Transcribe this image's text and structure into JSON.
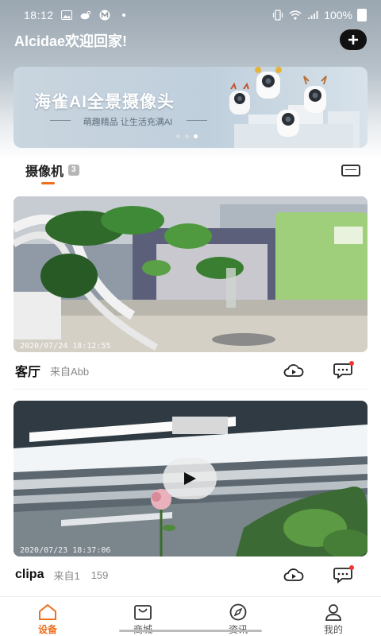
{
  "status_bar": {
    "time": "18:12",
    "battery": "100%"
  },
  "header": {
    "greeting": "Alcidae欢迎回家!",
    "add_icon": "plus-icon"
  },
  "banner": {
    "title": "海雀AI全景摄像头",
    "subtitle": "萌趣精品 让生活充满AI",
    "slide_count": 3,
    "active_slide": 3
  },
  "section": {
    "title": "摄像机",
    "count": "3"
  },
  "cameras": [
    {
      "name": "客厅",
      "source": "来自Abb",
      "extra": "",
      "timestamp": "2020/07/24  18:12:55"
    },
    {
      "name": "clipa",
      "source": "来自1",
      "extra": "159",
      "timestamp": "2020/07/23  18:37:06"
    }
  ],
  "bottom_nav": [
    {
      "label": "设备",
      "icon": "home-icon",
      "active": true
    },
    {
      "label": "商城",
      "icon": "shop-bag-icon",
      "active": false
    },
    {
      "label": "资讯",
      "icon": "compass-icon",
      "active": false
    },
    {
      "label": "我的",
      "icon": "user-icon",
      "active": false
    }
  ],
  "colors": {
    "accent": "#ef6f1d",
    "notification": "#f2352c"
  }
}
